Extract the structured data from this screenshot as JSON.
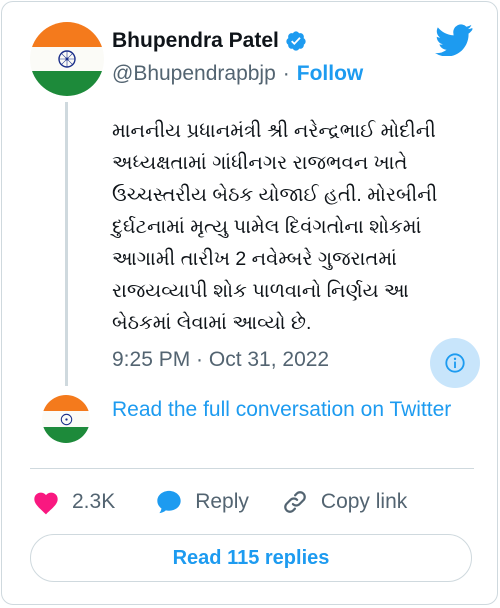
{
  "tweet": {
    "author": {
      "display_name": "Bhupendra Patel",
      "handle": "@Bhupendrapbjp",
      "verified": true,
      "avatar_icon": "indian-flag-avatar"
    },
    "separator": "·",
    "follow_label": "Follow",
    "text": "માનનીય પ્રધાનમંત્રી શ્રી નરેન્દ્રભાઈ મોદીની\nઅધ્યક્ષતામાં ગાંધીનગર રાજભવન ખાતે\nઉચ્ચસ્તરીય બેઠક યોજાઈ હતી. મોરબીની\nદુર્ઘટનામાં મૃત્યુ પામેલ દિવંગતોના શોકમાં\nઆગામી તારીખ 2 નવેમ્બરે ગુજરાતમાં\nરાજયવ્યાપી શોક પાળવાનો નિર્ણય આ\nબેઠકમાં લેવામાં આવ્યો છે.",
    "timestamp": "9:25 PM · Oct 31, 2022",
    "read_conversation": "Read the full conversation on Twitter",
    "actions": {
      "likes_count": "2.3K",
      "reply_label": "Reply",
      "copy_link_label": "Copy link"
    },
    "read_replies_label": "Read 115 replies"
  },
  "colors": {
    "accent": "#1d9bf0",
    "like": "#f91880",
    "muted": "#536471",
    "border": "#cfd9de",
    "flag_saffron": "#f47a1c",
    "flag_green": "#1d8a3a"
  },
  "icons": [
    "twitter-bird-icon",
    "verified-badge-icon",
    "info-icon",
    "heart-icon",
    "reply-bubble-icon",
    "link-icon"
  ]
}
